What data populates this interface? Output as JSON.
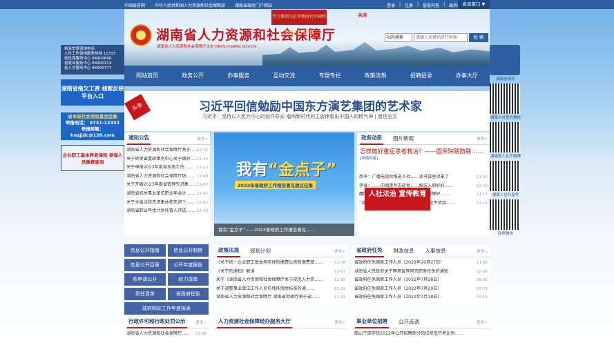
{
  "topbar": {
    "links": [
      "中国政府网",
      "中华人民共和国人力资源和社会保障部",
      "湖南省政府门户网站"
    ],
    "user_links": [
      "登录",
      "注册",
      "智能问答",
      "政务邮箱"
    ],
    "region": "省直窗口 ▼"
  },
  "header": {
    "title": "湖南省人力资源和社会保障厅",
    "subtitle": "湖南省人力资源和社会保障厅主办  HRSS.HUNAN.GOV.CN",
    "banner": "学习贯彻习近平新时代中国特色社会主义思想",
    "tag": "关闭"
  },
  "search": {
    "scope": "站内搜索",
    "placeholder": "请输入关键词进行检索",
    "button": "检 索"
  },
  "nav": [
    "网站首页",
    "政务公开",
    "办事服务",
    "互动交流",
    "专题专栏",
    "政策法规",
    "招聘招录",
    "办事大厅"
  ],
  "leftbox": {
    "lines": [
      "相关举报咨询电话",
      "人社工作咨询服务热线 12333",
      "省社保服务中心 84900666",
      "省就业服务中心 84900114",
      "省人才服务中心 84900777"
    ]
  },
  "ads": {
    "ad1": "湖南省拖欠工资 线索反映平台入口",
    "ad2_title": "省本级社会保险基金监督",
    "ad2_phone": "举报电话： 0731-12333",
    "ad2_mail": "举报邮箱：hnsjjdc@126.com",
    "ad3": "企业职工基本养老保险 参保人员缴费查询"
  },
  "rightbar": {
    "gov_label": "湖南省政府",
    "qr_labels": [
      "湖南人社官方微信",
      "湖南省人社厅微博",
      "湖南人社抖音号",
      "政务微信"
    ]
  },
  "headline": {
    "stamp": "头条",
    "title": "习近平回信勉励中国东方演艺集团的艺术家",
    "sub": "习近平：坚持以人民为中心的创作导向  唱响新时代的主旋律奏出中国人的精气神 | 音信全文"
  },
  "notice": {
    "tab": "通知公告",
    "more": "更多>",
    "items": [
      {
        "t": "湖南省人力资源和社会保障厅关于……",
        "d": "12-15"
      },
      {
        "t": "关于转发省委政事务中心关于做好……",
        "d": "12-14"
      },
      {
        "t": "关于申报2023年度省本级工伤……",
        "d": "12-13"
      },
      {
        "t": "湖南省人力资源和社会保障厅统……",
        "d": "12-08"
      },
      {
        "t": "关于开展2023年度省管理先进集……",
        "d": "12-07"
      },
      {
        "t": "湖南省机关事业单位职业年金计……",
        "d": "12-02"
      },
      {
        "t": "关于全省法院先进集体和先进个……",
        "d": "12-01"
      },
      {
        "t": "湖南省职业年金计划托管人评选……",
        "d": "11-28"
      }
    ]
  },
  "feature": {
    "slogan1": "我有",
    "slogan2": "“金点子”",
    "sub": "2023年省政府工作报告意见建议征集",
    "caption": "我有“金点子”——2023省政府工作报告意见……"
  },
  "news": {
    "tabs": [
      "政务动态",
      "图片新闻"
    ],
    "more": "更多>",
    "headline": "怎样做好重症患者救治？——国务院联防联……",
    "link": "[详细内容]",
    "items": [
      {
        "t": "西平：广播电视台推进人社……读书讲座读来了",
        "d": "12-20"
      },
      {
        "t": "李贤：……中国青年志愿者……推送入职好好……",
        "d": "12-19"
      },
      {
        "t": "醴陵：……健康创新驱动……以更好拼搏好……",
        "d": "12-17"
      },
      {
        "t": "“湖易办”省级服务演正式上线 毛德明宣传项目……",
        "d": "12-16"
      }
    ],
    "popup": "人社法治 宣传教育"
  },
  "policy": {
    "tabs": [
      "政策法规",
      "规划计划"
    ],
    "more": "更多>",
    "items": [
      {
        "t": "《关于统一企业职工基本养老保险缴费比例和缴费基……",
        "d": "12-08"
      },
      {
        "t": "《关于的通知》解读",
        "d": "12-01"
      },
      {
        "t": "关于《湖南省人力资源和社会保障厅关于规范人力资……",
        "d": "11-30"
      },
      {
        "t": "关于调整事业单位工作人员伤残抚恤金标准的通……",
        "d": "11-24"
      },
      {
        "t": "湖南省人力资源和社会保障厅 湖南省财政厅关于调……",
        "d": "11-15"
      }
    ]
  },
  "appointments": {
    "tabs": [
      "省政府任免",
      "财政信息",
      "人事信息"
    ],
    "more": "更多>",
    "items": [
      {
        "t": "省政府任免国家工作人员（2022年10月27日）",
        "d": "11-01"
      },
      {
        "t": "湖南省人民政府关于聘用省等同志职务任免的通知",
        "d": "10-28"
      },
      {
        "t": "省政府任免国家工作人员（2022年7月28日）",
        "d": "08-01"
      },
      {
        "t": "省政府任免国家工作人员（2022年7月29日）",
        "d": "07-29"
      },
      {
        "t": "省政府任免国家工作人员（2022年7月18日）",
        "d": "07-19"
      }
    ]
  },
  "buttons": [
    "信息公开指南",
    "信息公开制度",
    "信息公开目录",
    "公开年度报告",
    "依申请公开",
    "权力清单",
    "责任清单",
    "省政府任免",
    "政府网站工作年度报表"
  ],
  "licensing": {
    "tab": "行政许可和行政处罚公示",
    "more": "更多>",
    "items": [
      {
        "t": "湖南省人力资源和社会保障厅……",
        "d": "12-08"
      }
    ]
  },
  "service": {
    "tab": "人力资源社会保障经办服务大厅",
    "more": "更多>"
  },
  "recruit": {
    "tabs": [
      "事业单位招聘",
      "公开选调"
    ],
    "more": "更多>",
    "items": [
      {
        "t": "韶山干部学院2022年公开招聘部分岗位降低开考比例……",
        "d": ""
      }
    ]
  }
}
